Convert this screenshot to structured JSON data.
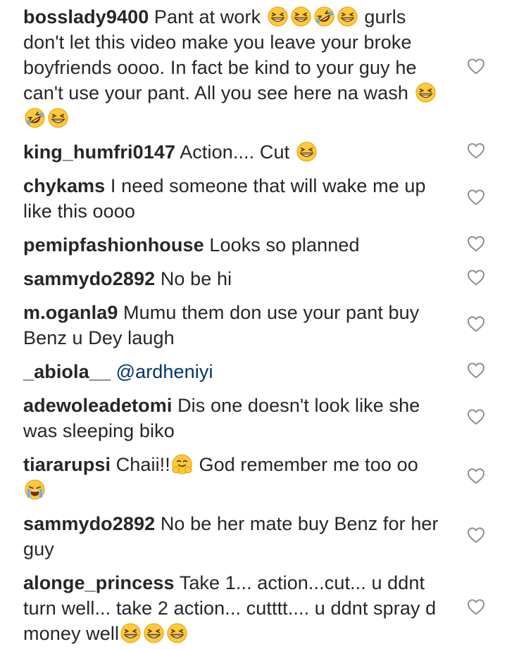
{
  "comments": [
    {
      "username": "bosslady9400",
      "pre": "Pant at work ",
      "emojis1": [
        "grin-squint",
        "grin-squint",
        "rofl",
        "grin-squint"
      ],
      "post": " gurls don't let this video make you leave your broke boyfriends oooo. In fact be kind to your guy he can't use your pant. All you see here na wash ",
      "emojis2": [
        "grin-squint",
        "rofl",
        "grin-squint"
      ]
    },
    {
      "username": "king_humfri0147",
      "pre": "Action.... Cut ",
      "emojis1": [
        "grin-squint"
      ]
    },
    {
      "username": "chykams",
      "pre": "I need someone that will wake me up like this oooo"
    },
    {
      "username": "pemipfashionhouse",
      "pre": "Looks so planned"
    },
    {
      "username": "sammydo2892",
      "pre": "No be hi"
    },
    {
      "username": "m.oganla9",
      "pre": "Mumu them don use your pant buy Benz u Dey laugh"
    },
    {
      "username": "_abiola__",
      "mention": "@ardheniyi"
    },
    {
      "username": "adewoleadetomi",
      "pre": "Dis one doesn't look like she was sleeping biko"
    },
    {
      "username": "tiararupsi",
      "pre": "Chaii!!",
      "emojis1": [
        "hugging"
      ],
      "post": " God remember me too oo ",
      "emojis2": [
        "crying-loud"
      ]
    },
    {
      "username": "sammydo2892",
      "pre": "No be her mate buy Benz for her guy"
    },
    {
      "username": "alonge_princess",
      "pre": "Take 1... action...cut... u ddnt turn well... take 2 action... cutttt.... u ddnt spray d money well",
      "emojis1": [
        "grin-squint",
        "grin-squint",
        "grin-squint"
      ]
    }
  ],
  "icons": {
    "like": "heart-outline-icon",
    "heart_color": "#8e8e8e",
    "emoji_face": "#ffc83d",
    "emoji_outline": "#e39a00"
  }
}
